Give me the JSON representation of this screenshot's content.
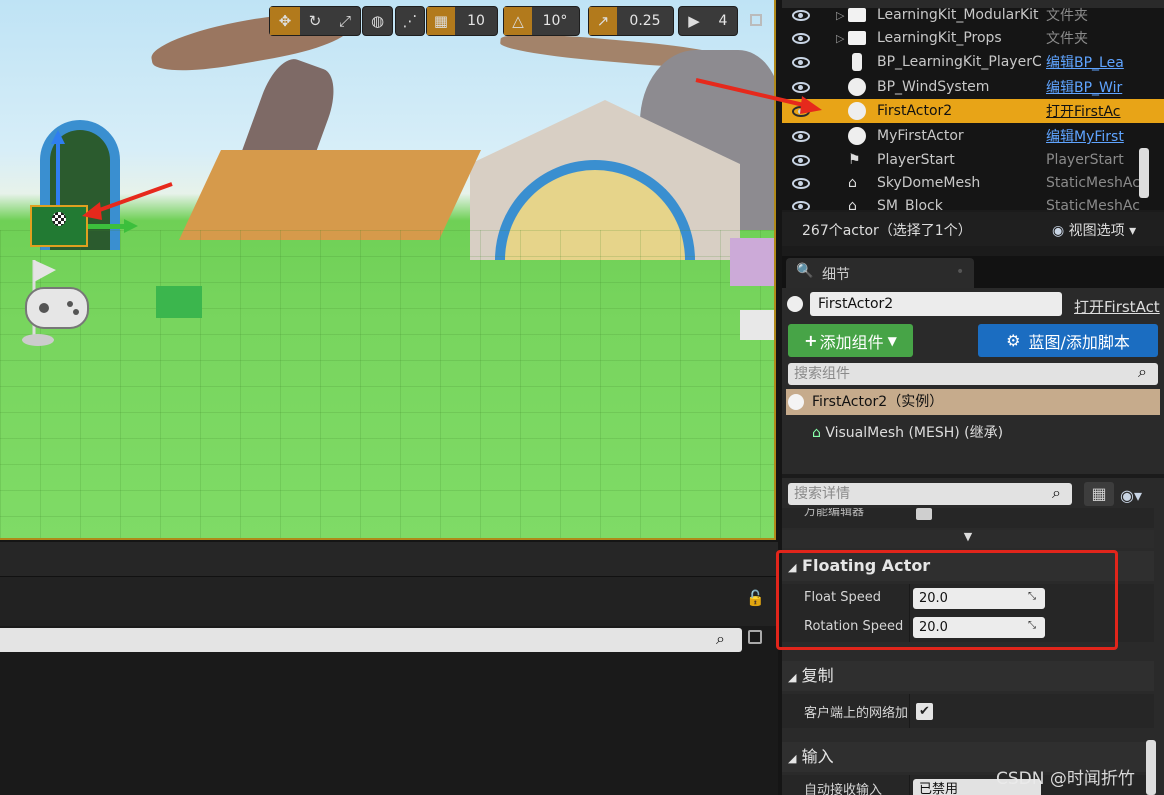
{
  "viewport": {
    "toolbar": {
      "grid_snap_value": "10",
      "rotation_snap_value": "10°",
      "scale_snap_value": "0.25",
      "camera_speed_value": "4"
    }
  },
  "outliner": {
    "rows": [
      {
        "name": "LearningKit_ModularKit",
        "type": "文件夹",
        "type_link": false,
        "icon": "folder-icon"
      },
      {
        "name": "LearningKit_Props",
        "type": "文件夹",
        "type_link": false,
        "icon": "folder-icon"
      },
      {
        "name": "BP_LearningKit_PlayerC",
        "type": "编辑BP_Lea",
        "type_link": true,
        "icon": "blueprint-actor-icon"
      },
      {
        "name": "BP_WindSystem",
        "type": "编辑BP_Wir",
        "type_link": true,
        "icon": "blueprint-actor-icon"
      },
      {
        "name": "FirstActor2",
        "type": "打开FirstAc",
        "type_link": true,
        "icon": "actor-sphere-icon",
        "selected": true
      },
      {
        "name": "MyFirstActor",
        "type": "编辑MyFirst",
        "type_link": true,
        "icon": "actor-sphere-icon"
      },
      {
        "name": "PlayerStart",
        "type": "PlayerStart",
        "type_link": false,
        "icon": "player-start-icon"
      },
      {
        "name": "SkyDomeMesh",
        "type": "StaticMeshAc",
        "type_link": false,
        "icon": "static-mesh-icon"
      },
      {
        "name": "SM_Block",
        "type": "StaticMeshAc",
        "type_link": false,
        "icon": "static-mesh-icon"
      }
    ],
    "actor_count": "267个actor（选择了1个）",
    "view_options": "视图选项"
  },
  "details": {
    "tab_label": "细节",
    "actor_name": "FirstActor2",
    "open_link": "打开FirstAct",
    "add_component": "添加组件",
    "blueprint_script": "蓝图/添加脚本",
    "search_components_placeholder": "搜索组件",
    "root_component": "FirstActor2（实例）",
    "child_component": "VisualMesh (MESH) (继承)",
    "search_details_placeholder": "搜索详情",
    "clipped_row_label": "万能编辑器",
    "sections": {
      "floating": {
        "title": "Floating Actor",
        "float_speed_label": "Float Speed",
        "float_speed_value": "20.0",
        "rotation_speed_label": "Rotation Speed",
        "rotation_speed_value": "20.0"
      },
      "replication": {
        "title": "复制",
        "net_load_label": "客户端上的网络加"
      },
      "input": {
        "title": "输入",
        "auto_receive_label": "自动接收输入",
        "auto_receive_value": "已禁用"
      }
    }
  },
  "watermark": "CSDN @时闻折竹"
}
